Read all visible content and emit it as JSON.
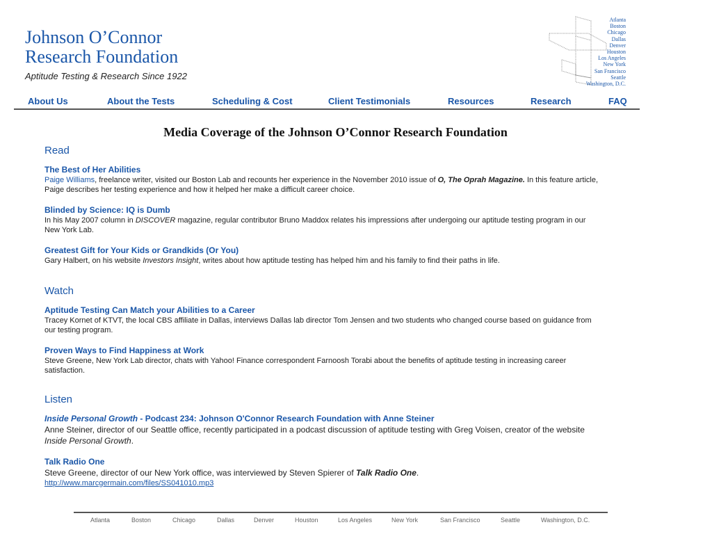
{
  "brand": {
    "line1": "Johnson O’Connor",
    "line2": "Research Foundation",
    "tagline": "Aptitude Testing & Research Since 1922"
  },
  "logo": {
    "cities": [
      "Atlanta",
      "Boston",
      "Chicago",
      "Dallas",
      "Denver",
      "Houston",
      "Los Angeles",
      "New York",
      "San Francisco",
      "Seattle",
      "Washington, D.C."
    ]
  },
  "nav": {
    "items": [
      "About Us",
      "About the Tests",
      "Scheduling & Cost",
      "Client Testimonials",
      "Resources",
      "Research",
      "FAQ"
    ]
  },
  "page_title": "Media Coverage of the Johnson O’Connor Research Foundation",
  "read": {
    "heading": "Read",
    "items": [
      {
        "title": "The Best of Her Abilities",
        "desc_parts": {
          "name": "Paige Williams",
          "a": ", freelance writer, visited our Boston Lab and recounts her experience in the November 2010 issue of ",
          "mag": "O, The Oprah Magazine.",
          "b": "  In this feature article, Paige describes her testing experience and how it helped her make a difficult career choice."
        }
      },
      {
        "title": "Blinded by Science: IQ is Dumb",
        "desc_parts": {
          "a": "In his May 2007 column in ",
          "mag": "DISCOVER",
          "b": " magazine, regular contributor Bruno Maddox relates his impressions after undergoing our aptitude testing program in our New York Lab."
        }
      },
      {
        "title": "Greatest Gift for Your Kids or Grandkids (Or You)",
        "desc_parts": {
          "a": "Gary Halbert, on his website ",
          "mag": "Investors Insight",
          "b": ", writes about how aptitude testing has helped him and his family to find their paths in life."
        }
      }
    ]
  },
  "watch": {
    "heading": "Watch",
    "items": [
      {
        "title": "Aptitude Testing Can Match your Abilities to a Career",
        "desc": "Tracey Kornet of KTVT, the local CBS affiliate in Dallas, interviews Dallas lab director Tom Jensen and two students who changed course based on guidance from our testing program."
      },
      {
        "title": "Proven Ways to Find Happiness at Work",
        "desc": "Steve Greene, New York Lab director, chats with Yahoo! Finance correspondent Farnoosh Torabi about the benefits of aptitude testing in increasing career satisfaction."
      }
    ]
  },
  "listen": {
    "heading": "Listen",
    "items": [
      {
        "title_italic": "Inside Personal Growth",
        "title_rest": " - Podcast 234: Johnson O'Connor Research Foundation with Anne Steiner",
        "desc_a": "Anne Steiner, director of our Seattle office, recently participated in a podcast discussion of aptitude testing with Greg Voisen, creator of the website ",
        "desc_mag": "Inside Personal Growth",
        "desc_b": "."
      },
      {
        "title": "Talk Radio One",
        "desc_a": "Steve Greene, director of our New York office, was interviewed by Steven Spierer of ",
        "desc_mag": "Talk Radio One",
        "desc_b": ".",
        "url": "http://www.marcgermain.com/files/SS041010.mp3"
      }
    ]
  },
  "footer": {
    "cities": [
      "Atlanta",
      "Boston",
      "Chicago",
      "Dallas",
      "Denver",
      "Houston",
      "Los Angeles",
      "New York",
      "San Francisco",
      "Seattle",
      "Washington, D.C."
    ]
  },
  "colors": {
    "brand_blue": "#1a56a8",
    "rule": "#555555"
  }
}
